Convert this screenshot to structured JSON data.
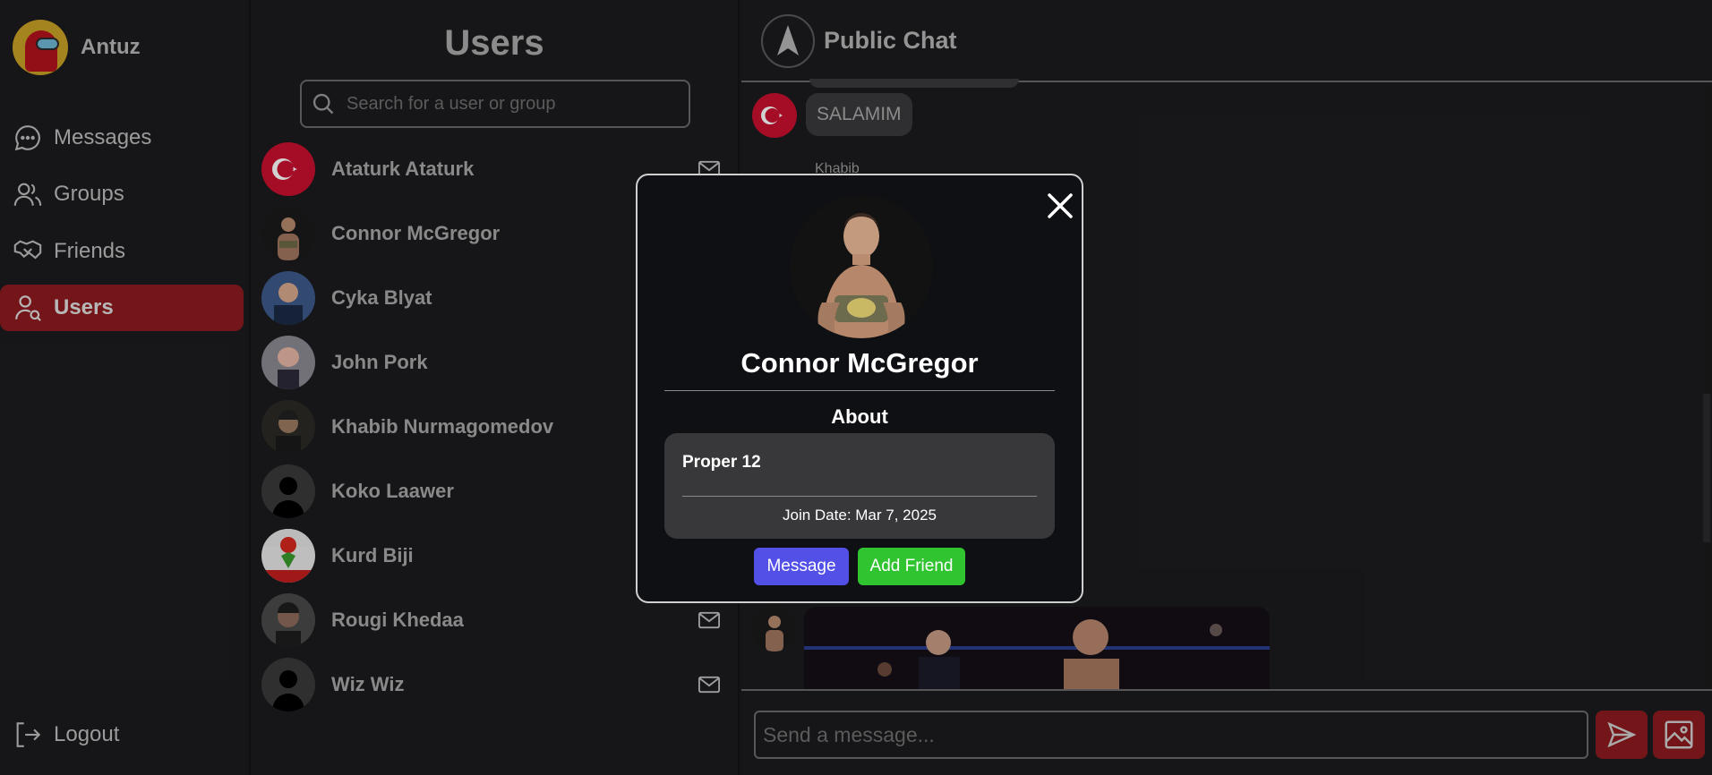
{
  "profile": {
    "name": "Antuz"
  },
  "nav": {
    "items": [
      {
        "label": "Messages",
        "icon": "chat-bubble-icon"
      },
      {
        "label": "Groups",
        "icon": "group-icon"
      },
      {
        "label": "Friends",
        "icon": "handshake-icon"
      },
      {
        "label": "Users",
        "icon": "user-search-icon",
        "active": true
      }
    ],
    "logout": "Logout"
  },
  "users_panel": {
    "title": "Users",
    "search_placeholder": "Search for a user or group",
    "users": [
      {
        "name": "Ataturk Ataturk"
      },
      {
        "name": "Connor McGregor"
      },
      {
        "name": "Cyka Blyat"
      },
      {
        "name": "John Pork"
      },
      {
        "name": "Khabib Nurmagomedov"
      },
      {
        "name": "Koko Laawer"
      },
      {
        "name": "Kurd Biji"
      },
      {
        "name": "Rougi Khedaa"
      },
      {
        "name": "Wiz Wiz"
      }
    ]
  },
  "chat": {
    "title": "Public Chat",
    "messages": [
      {
        "text": "SALAMIM"
      }
    ],
    "next_sender": "Khabib",
    "composer_placeholder": "Send a message..."
  },
  "modal": {
    "name": "Connor McGregor",
    "about_heading": "About",
    "bio": "Proper 12",
    "join_date": "Join Date: Mar 7, 2025",
    "message_button": "Message",
    "add_friend_button": "Add Friend"
  },
  "colors": {
    "accent_red": "#8e1c1f",
    "message_button": "#5250e6",
    "add_friend_button": "#31c431"
  }
}
